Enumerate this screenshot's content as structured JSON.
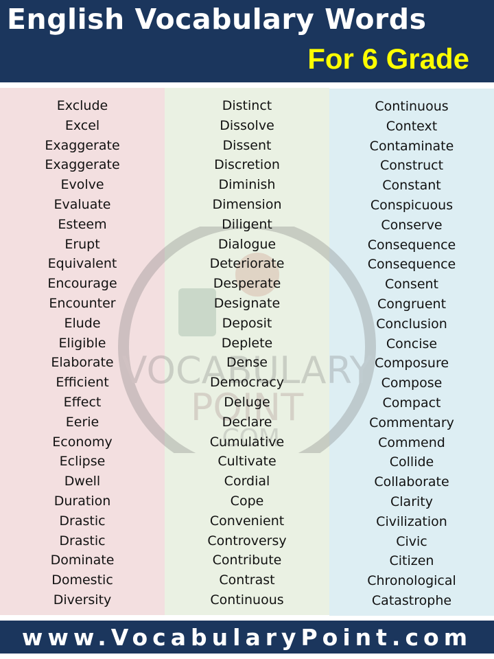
{
  "header": {
    "title": "English Vocabulary Words",
    "subtitle": "For 6 Grade"
  },
  "colors": {
    "header_bg": "#1b365d",
    "title_color": "#ffffff",
    "subtitle_color": "#ffff00",
    "column_1_bg": "#f3dfe0",
    "column_2_bg": "#eaf1e3",
    "column_3_bg": "#ddeef3"
  },
  "watermark": {
    "line1": "VOCABULARY",
    "line2": "POINT",
    "line3": ".COM",
    "icon": "lightbulb-book-icon"
  },
  "columns": [
    {
      "words": [
        "Exclude",
        "Excel",
        "Exaggerate",
        "Exaggerate",
        "Evolve",
        "Evaluate",
        "Esteem",
        "Erupt",
        "Equivalent",
        "Encourage",
        "Encounter",
        "Elude",
        "Eligible",
        "Elaborate",
        "Efficient",
        "Effect",
        "Eerie",
        "Economy",
        "Eclipse",
        "Dwell",
        "Duration",
        "Drastic",
        "Drastic",
        "Dominate",
        "Domestic",
        "Diversity"
      ]
    },
    {
      "words": [
        "Distinct",
        "Dissolve",
        "Dissent",
        "Discretion",
        "Diminish",
        "Dimension",
        "Diligent",
        "Dialogue",
        "Deteriorate",
        "Desperate",
        "Designate",
        "Deposit",
        "Deplete",
        "Dense",
        "Democracy",
        "Deluge",
        "Declare",
        "Cumulative",
        "Cultivate",
        "Cordial",
        "Cope",
        "Convenient",
        "Controversy",
        "Contribute",
        "Contrast",
        "Continuous"
      ]
    },
    {
      "words": [
        "Continuous",
        "Context",
        "Contaminate",
        "Construct",
        "Constant",
        "Conspicuous",
        "Conserve",
        "Consequence",
        "Consequence",
        "Consent",
        "Congruent",
        "Conclusion",
        "Concise",
        "Composure",
        "Compose",
        "Compact",
        "Commentary",
        "Commend",
        "Collide",
        "Collaborate",
        "Clarity",
        "Civilization",
        "Civic",
        "Citizen",
        "Chronological",
        "Catastrophe"
      ]
    }
  ],
  "footer": {
    "url": "www.VocabularyPoint.com"
  }
}
